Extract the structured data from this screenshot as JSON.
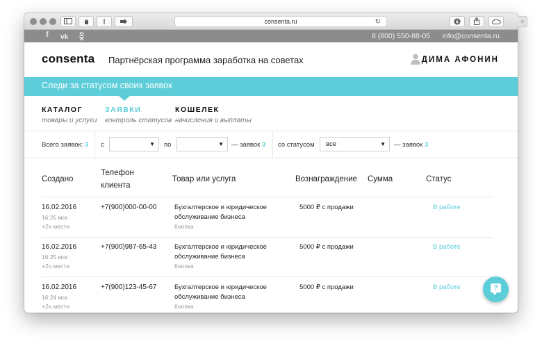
{
  "browser": {
    "url": "consenta.ru",
    "reload_glyph": "↻"
  },
  "topbar": {
    "social": [
      "f",
      "vk",
      "ok"
    ],
    "phone": "8 (800) 550-88-05",
    "email": "info@consenta.ru"
  },
  "header": {
    "logo": "consenta",
    "tagline": "Партнёрская программа заработка на советах",
    "user": "ДИМА АФОНИН"
  },
  "banner": {
    "text": "Следи за статусом своих заявок"
  },
  "tabs": [
    {
      "title": "КАТАЛОГ",
      "subtitle": "товары и услуги",
      "active": false
    },
    {
      "title": "ЗАЯВКИ",
      "subtitle": "контроль статусов",
      "active": true
    },
    {
      "title": "КОШЕЛЕК",
      "subtitle": "начисления и выплаты",
      "active": false
    }
  ],
  "filters": {
    "total_label": "Всего заявок:",
    "total_count": "3",
    "from_label": "с",
    "from_value": "",
    "to_label": "по",
    "to_value": "",
    "count_label_1": "— заявок",
    "count_1": "3",
    "status_label": "со статусом",
    "status_value": "все",
    "count_label_2": "— заявок",
    "count_2": "3"
  },
  "table": {
    "headers": {
      "created": "Создано",
      "phone": "Телефон клиента",
      "product": "Товар или услуга",
      "reward": "Вознаграждение",
      "sum": "Сумма",
      "status": "Статус"
    },
    "rows": [
      {
        "date": "16.02.2016",
        "time": "16:26 мск",
        "local": "+2ч местн",
        "phone": "+7(900)000-00-00",
        "product": "Бухгалтерское и юридическое обслуживание бизнеса",
        "product_sub": "Кнопка",
        "reward": "5000 ₽ с продажи",
        "sum": "",
        "status": "В работе"
      },
      {
        "date": "16.02.2016",
        "time": "16:25 мск",
        "local": "+2ч местн",
        "phone": "+7(900)987-65-43",
        "product": "Бухгалтерское и юридическое обслуживание бизнеса",
        "product_sub": "Кнопка",
        "reward": "5000 ₽ с продажи",
        "sum": "",
        "status": "В работе"
      },
      {
        "date": "16.02.2016",
        "time": "16:24 мск",
        "local": "+2ч местн",
        "phone": "+7(900)123-45-67",
        "product": "Бухгалтерское и юридическое обслуживание бизнеса",
        "product_sub": "Кнопка",
        "reward": "5000 ₽ с продажи",
        "sum": "",
        "status": "В работе"
      }
    ]
  },
  "fab": {
    "glyph": "?"
  },
  "colors": {
    "accent": "#5ccdd9",
    "topbar": "#8c8c8c"
  }
}
